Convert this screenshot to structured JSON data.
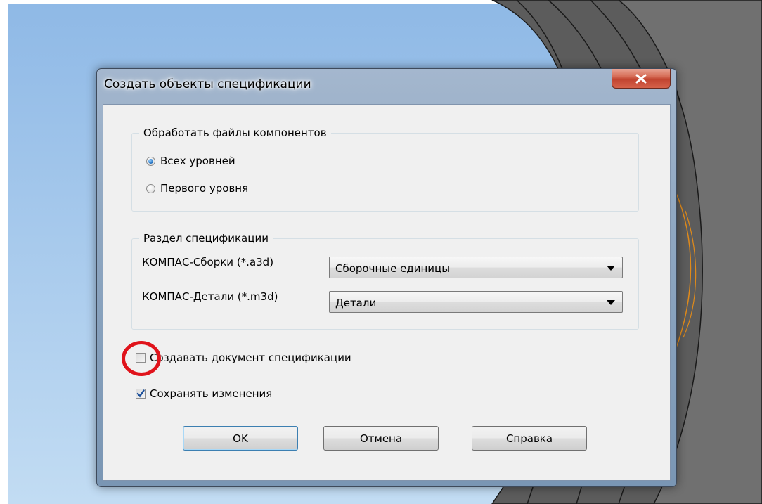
{
  "dialog": {
    "title": "Создать объекты спецификации",
    "close_icon": "close-icon"
  },
  "process_group": {
    "legend": "Обработать файлы компонентов",
    "options": [
      {
        "label": "Всех уровней",
        "selected": true
      },
      {
        "label": "Первого уровня",
        "selected": false
      }
    ]
  },
  "section_group": {
    "legend": "Раздел спецификации",
    "rows": [
      {
        "label": "КОМПАС-Сборки (*.a3d)",
        "value": "Сборочные единицы"
      },
      {
        "label": "КОМПАС-Детали (*.m3d)",
        "value": "Детали"
      }
    ]
  },
  "options": {
    "create_doc": {
      "label": "Создавать документ спецификации",
      "checked": false
    },
    "save_changes": {
      "label": "Сохранять изменения",
      "checked": true
    }
  },
  "buttons": {
    "ok": "OK",
    "cancel": "Отмена",
    "help": "Справка"
  },
  "colors": {
    "desktop": "#9ec3e8",
    "annotation": "#e0131b"
  }
}
